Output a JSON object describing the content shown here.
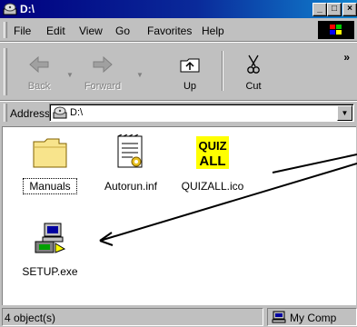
{
  "window": {
    "title": "D:\\",
    "icon": "cd-drive-icon",
    "minimize_label": "_",
    "maximize_label": "□",
    "close_label": "×"
  },
  "menu": {
    "file": "File",
    "edit": "Edit",
    "view": "View",
    "go": "Go",
    "favorites": "Favorites",
    "help": "Help"
  },
  "toolbar": {
    "back": "Back",
    "forward": "Forward",
    "up": "Up",
    "cut": "Cut",
    "more": "»"
  },
  "address": {
    "label": "Address",
    "value": "D:\\"
  },
  "files": [
    {
      "name": "Manuals",
      "icon": "folder-icon"
    },
    {
      "name": "Autorun.inf",
      "icon": "inf-file-icon"
    },
    {
      "name": "QUIZALL.ico",
      "icon": "quizall-icon",
      "icon_text_1": "QUIZ",
      "icon_text_2": "ALL"
    },
    {
      "name": "SETUP.exe",
      "icon": "setup-exe-icon"
    }
  ],
  "status": {
    "count": "4 object(s)",
    "zone": "My Comp"
  },
  "colors": {
    "title_bar": "#000080",
    "chrome": "#c0c0c0",
    "content_bg": "#ffffff"
  }
}
